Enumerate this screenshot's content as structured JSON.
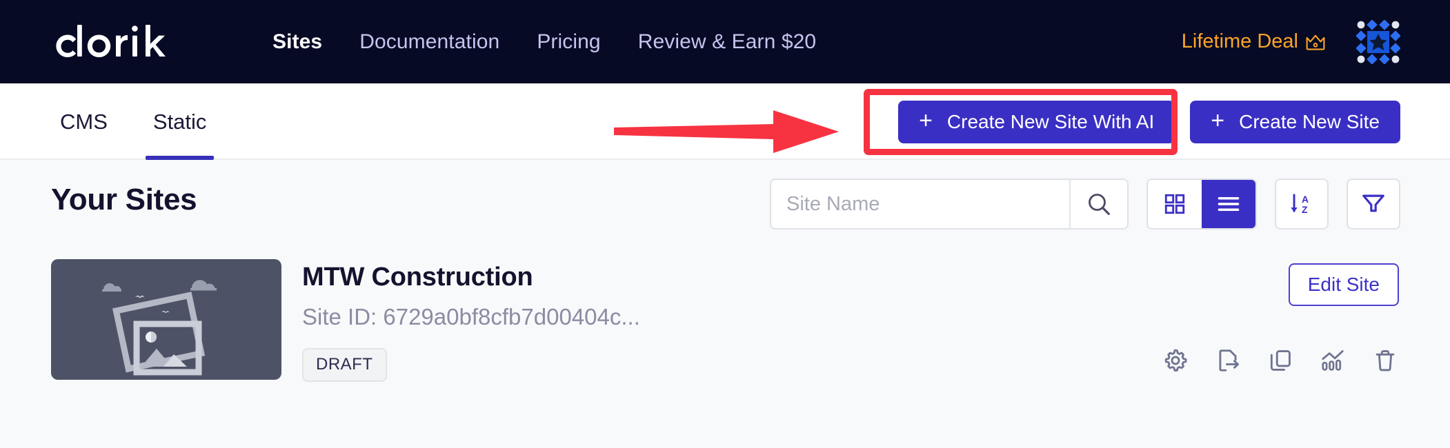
{
  "navbar": {
    "brand": "dorik",
    "brand_icon": "dorik-wordmark",
    "links": [
      {
        "label": "Sites",
        "active": true
      },
      {
        "label": "Documentation",
        "active": false
      },
      {
        "label": "Pricing",
        "active": false
      },
      {
        "label": "Review & Earn $20",
        "active": false
      }
    ],
    "lifetime_deal": {
      "label": "Lifetime Deal",
      "icon": "crown-icon"
    },
    "avatar_icon": "dorik-diamond-logo",
    "bg_color": "#060a24",
    "accent_color": "#fca427",
    "link_color": "#c6c4ef"
  },
  "tabbar": {
    "tabs": [
      {
        "label": "CMS",
        "active": false
      },
      {
        "label": "Static",
        "active": true
      }
    ],
    "create_with_ai": {
      "label": "Create New Site With AI",
      "icon": "plus-icon"
    },
    "create_new": {
      "label": "Create New Site",
      "icon": "plus-icon"
    },
    "active_underline_color": "#3730b8",
    "primary_color": "#3a2fc4"
  },
  "annotation": {
    "highlight_color": "#f73341",
    "arrow_icon": "right-arrow-annotation",
    "target": "Create New Site With AI"
  },
  "main": {
    "title": "Your Sites",
    "search": {
      "placeholder": "Site Name",
      "value": "",
      "icon": "search-icon"
    },
    "view_toggle": [
      {
        "icon": "grid-view-icon",
        "active": false
      },
      {
        "icon": "list-view-icon",
        "active": true
      }
    ],
    "sort_button": {
      "icon": "sort-az-icon",
      "label": "A Z"
    },
    "filter_button": {
      "icon": "filter-funnel-icon"
    },
    "sites": [
      {
        "name": "MTW Construction",
        "site_id": "Site ID: 6729a0bf8cfb7d00404c...",
        "status": "DRAFT",
        "thumbnail_icon": "image-placeholder-icon",
        "edit_label": "Edit Site",
        "actions": [
          {
            "icon": "gear-icon",
            "name": "settings"
          },
          {
            "icon": "export-icon",
            "name": "export"
          },
          {
            "icon": "duplicate-icon",
            "name": "duplicate"
          },
          {
            "icon": "analytics-icon",
            "name": "analytics"
          },
          {
            "icon": "trash-icon",
            "name": "delete"
          }
        ]
      }
    ]
  }
}
